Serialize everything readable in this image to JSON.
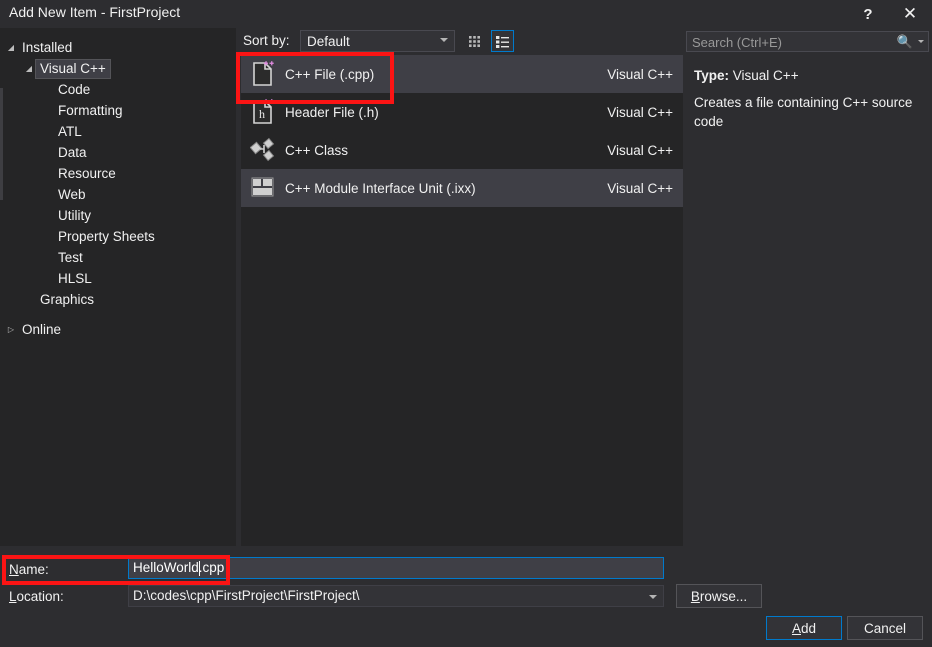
{
  "window": {
    "title": "Add New Item - FirstProject",
    "help_icon": "?",
    "help_icon_name": "help-icon",
    "close_icon": "✕",
    "close_icon_name": "close-icon",
    "background": "#2d2d30",
    "accent": "#007acc",
    "annotation_color": "#fb1414"
  },
  "sidebar": {
    "groups": [
      {
        "label": "Installed",
        "level": 0,
        "expanded": true,
        "twisty": "◢",
        "selected": false
      },
      {
        "label": "Visual C++",
        "level": 1,
        "expanded": true,
        "twisty": "◢",
        "selected": true
      },
      {
        "label": "Code",
        "level": 2,
        "expanded": null,
        "twisty": "",
        "selected": false
      },
      {
        "label": "Formatting",
        "level": 2,
        "expanded": null,
        "twisty": "",
        "selected": false
      },
      {
        "label": "ATL",
        "level": 2,
        "expanded": null,
        "twisty": "",
        "selected": false
      },
      {
        "label": "Data",
        "level": 2,
        "expanded": null,
        "twisty": "",
        "selected": false
      },
      {
        "label": "Resource",
        "level": 2,
        "expanded": null,
        "twisty": "",
        "selected": false
      },
      {
        "label": "Web",
        "level": 2,
        "expanded": null,
        "twisty": "",
        "selected": false
      },
      {
        "label": "Utility",
        "level": 2,
        "expanded": null,
        "twisty": "",
        "selected": false
      },
      {
        "label": "Property Sheets",
        "level": 2,
        "expanded": null,
        "twisty": "",
        "selected": false
      },
      {
        "label": "Test",
        "level": 2,
        "expanded": null,
        "twisty": "",
        "selected": false
      },
      {
        "label": "HLSL",
        "level": 2,
        "expanded": null,
        "twisty": "",
        "selected": false
      },
      {
        "label": "Graphics",
        "level": 1,
        "expanded": null,
        "twisty": "",
        "selected": false
      },
      {
        "label": "Online",
        "level": 0,
        "expanded": false,
        "twisty": "▷",
        "selected": false
      }
    ]
  },
  "toolbar": {
    "sort_label": "Sort by:",
    "sort_value": "Default",
    "sort_options": [
      "Default"
    ],
    "grid_view_icon": "grid-view-icon",
    "list_view_icon": "list-view-icon",
    "active_view": "list"
  },
  "item_list": {
    "items": [
      {
        "name": "C++ File (.cpp)",
        "origin": "Visual C++",
        "icon": "cpp-file-icon",
        "shaded": true,
        "selected": true
      },
      {
        "name": "Header File (.h)",
        "origin": "Visual C++",
        "icon": "header-file-icon",
        "shaded": false,
        "selected": false
      },
      {
        "name": "C++ Class",
        "origin": "Visual C++",
        "icon": "cpp-class-icon",
        "shaded": false,
        "selected": false
      },
      {
        "name": "C++ Module Interface Unit (.ixx)",
        "origin": "Visual C++",
        "icon": "cpp-module-icon",
        "shaded": true,
        "selected": false
      }
    ]
  },
  "search": {
    "placeholder": "Search (Ctrl+E)",
    "value": "",
    "icon": "search-icon"
  },
  "details": {
    "type_label": "Type:",
    "type_value": " Visual C++",
    "description": "Creates a file containing C++ source code"
  },
  "form": {
    "name_label_acc": "N",
    "name_label_rest": "ame:",
    "name_value": "HelloWorld.cpp",
    "name_caret_after": "HelloWorld",
    "location_label_acc": "L",
    "location_label_rest": "ocation:",
    "location_value": "D:\\codes\\cpp\\FirstProject\\FirstProject\\"
  },
  "buttons": {
    "browse_acc": "B",
    "browse_rest": "rowse...",
    "add_acc": "A",
    "add_rest": "dd",
    "cancel": "Cancel"
  }
}
